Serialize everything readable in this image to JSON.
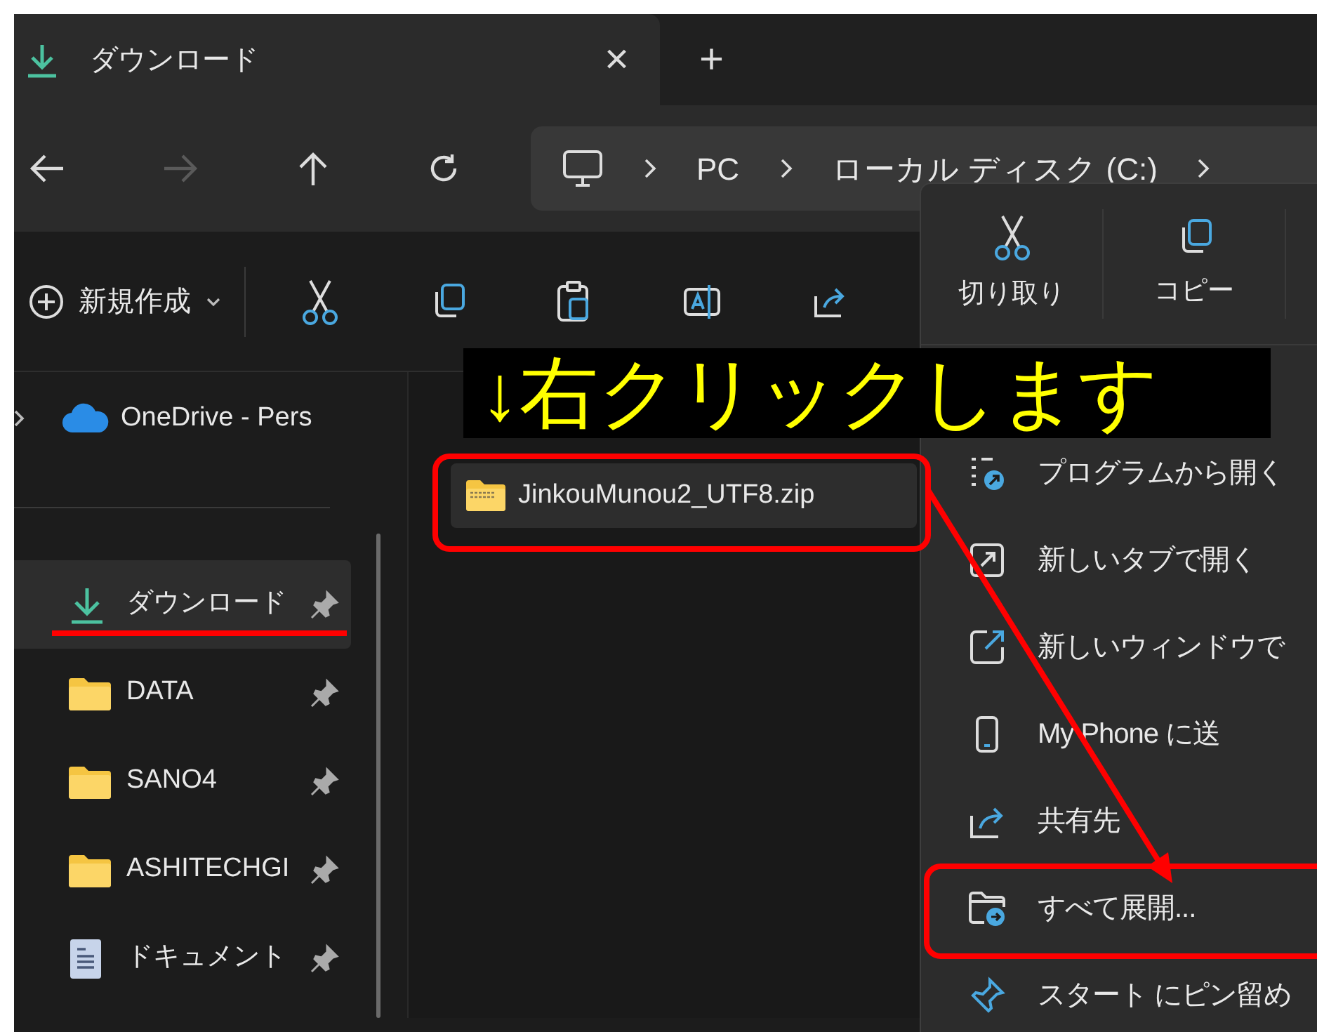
{
  "tab": {
    "title": "ダウンロード",
    "close": "×",
    "new": "+"
  },
  "nav": {
    "forward_disabled": true
  },
  "address": {
    "segments": [
      "PC",
      "ローカル ディスク (C:)"
    ]
  },
  "toolbar": {
    "new_label": "新規作成"
  },
  "sidebar": {
    "cloud": "OneDrive - Pers",
    "items": [
      {
        "kind": "download",
        "label": "ダウンロード",
        "selected": true,
        "pinned": true
      },
      {
        "kind": "folder",
        "label": "DATA",
        "selected": false,
        "pinned": true
      },
      {
        "kind": "folder",
        "label": "SANO4",
        "selected": false,
        "pinned": true
      },
      {
        "kind": "folder",
        "label": "ASHITECHGI",
        "selected": false,
        "pinned": true
      },
      {
        "kind": "document",
        "label": "ドキュメント",
        "selected": false,
        "pinned": true
      }
    ]
  },
  "files": [
    {
      "name": "JinkouMunou2_UTF8.zip",
      "selected": true
    }
  ],
  "context_menu": {
    "actions": [
      {
        "kind": "cut",
        "label": "切り取り"
      },
      {
        "kind": "copy",
        "label": "コピー"
      }
    ],
    "items": [
      {
        "kind": "open-with",
        "label": "プログラムから開く"
      },
      {
        "kind": "new-tab",
        "label": "新しいタブで開く"
      },
      {
        "kind": "new-window",
        "label": "新しいウィンドウで"
      },
      {
        "kind": "phone",
        "label": "My Phone に送"
      },
      {
        "kind": "share",
        "label": "共有先"
      },
      {
        "kind": "extract",
        "label": "すべて展開..."
      },
      {
        "kind": "pin",
        "label": "スタート にピン留め"
      }
    ]
  },
  "annotation": {
    "caption": "↓右クリックします"
  }
}
